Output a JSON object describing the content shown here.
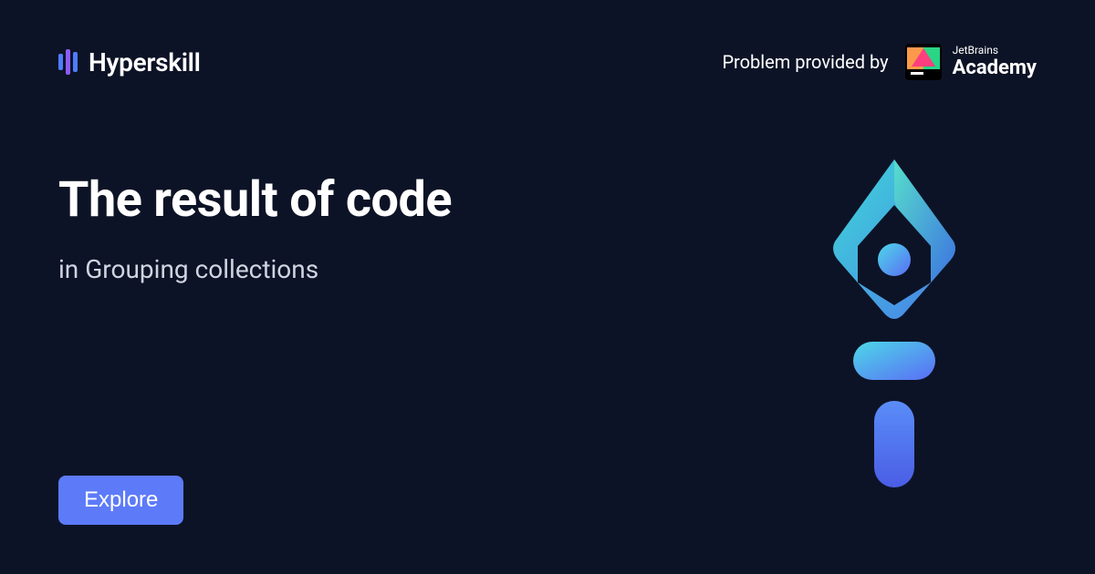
{
  "header": {
    "logo_text": "Hyperskill",
    "provider_text": "Problem provided by",
    "jetbrains_small": "JetBrains",
    "jetbrains_large": "Academy"
  },
  "main": {
    "title": "The result of code",
    "subtitle": "in Grouping collections"
  },
  "cta": {
    "explore_label": "Explore"
  }
}
